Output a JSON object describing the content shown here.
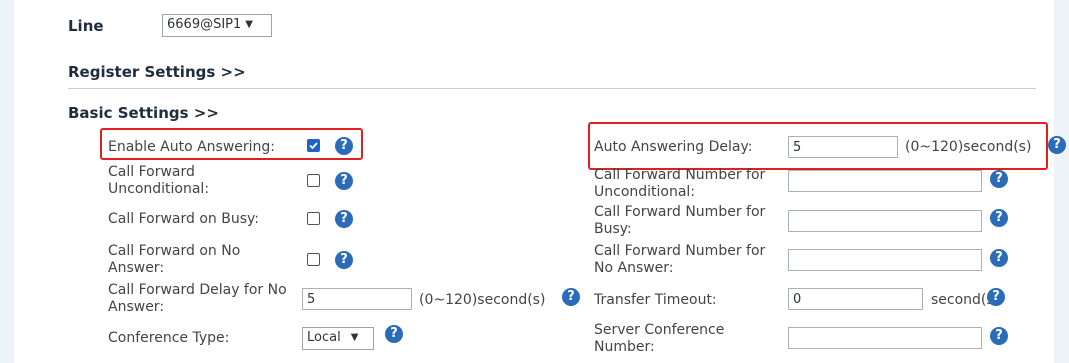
{
  "line": {
    "label": "Line",
    "value": "6669@SIP1"
  },
  "sections": {
    "register": "Register Settings >>",
    "basic": "Basic Settings >>"
  },
  "left": {
    "enable_auto_answering": {
      "label": "Enable Auto Answering:",
      "checked": true
    },
    "cf_unconditional": {
      "label_line1": "Call Forward",
      "label_line2": "Unconditional:",
      "checked": false
    },
    "cf_busy": {
      "label": "Call Forward on Busy:",
      "checked": false
    },
    "cf_no_answer": {
      "label_line1": "Call Forward on No",
      "label_line2": "Answer:",
      "checked": false
    },
    "cf_delay_no_answer": {
      "label_line1": "Call Forward Delay for No",
      "label_line2": "Answer:",
      "value": "5",
      "unit": "(0~120)second(s)"
    },
    "conference_type": {
      "label": "Conference Type:",
      "value": "Local"
    }
  },
  "right": {
    "auto_answering_delay": {
      "label": "Auto Answering Delay:",
      "value": "5",
      "unit": "(0~120)second(s)"
    },
    "cfn_unconditional": {
      "label_line1": "Call Forward Number for",
      "label_line2": "Unconditional:",
      "value": ""
    },
    "cfn_busy": {
      "label_line1": "Call Forward Number for",
      "label_line2": "Busy:",
      "value": ""
    },
    "cfn_no_answer": {
      "label_line1": "Call Forward Number for",
      "label_line2": "No Answer:",
      "value": ""
    },
    "transfer_timeout": {
      "label": "Transfer Timeout:",
      "value": "0",
      "unit": "second(s)"
    },
    "server_conference_number": {
      "label_line1": "Server Conference",
      "label_line2": "Number:",
      "value": ""
    }
  },
  "colors": {
    "highlight": "#e02020",
    "help_icon": "#2b6cb8",
    "checkbox_on": "#1e63c8"
  },
  "icons": {
    "help": "help-icon",
    "dropdown": "chevron-down-icon",
    "check": "checkmark-icon"
  },
  "help_glyph": "?"
}
